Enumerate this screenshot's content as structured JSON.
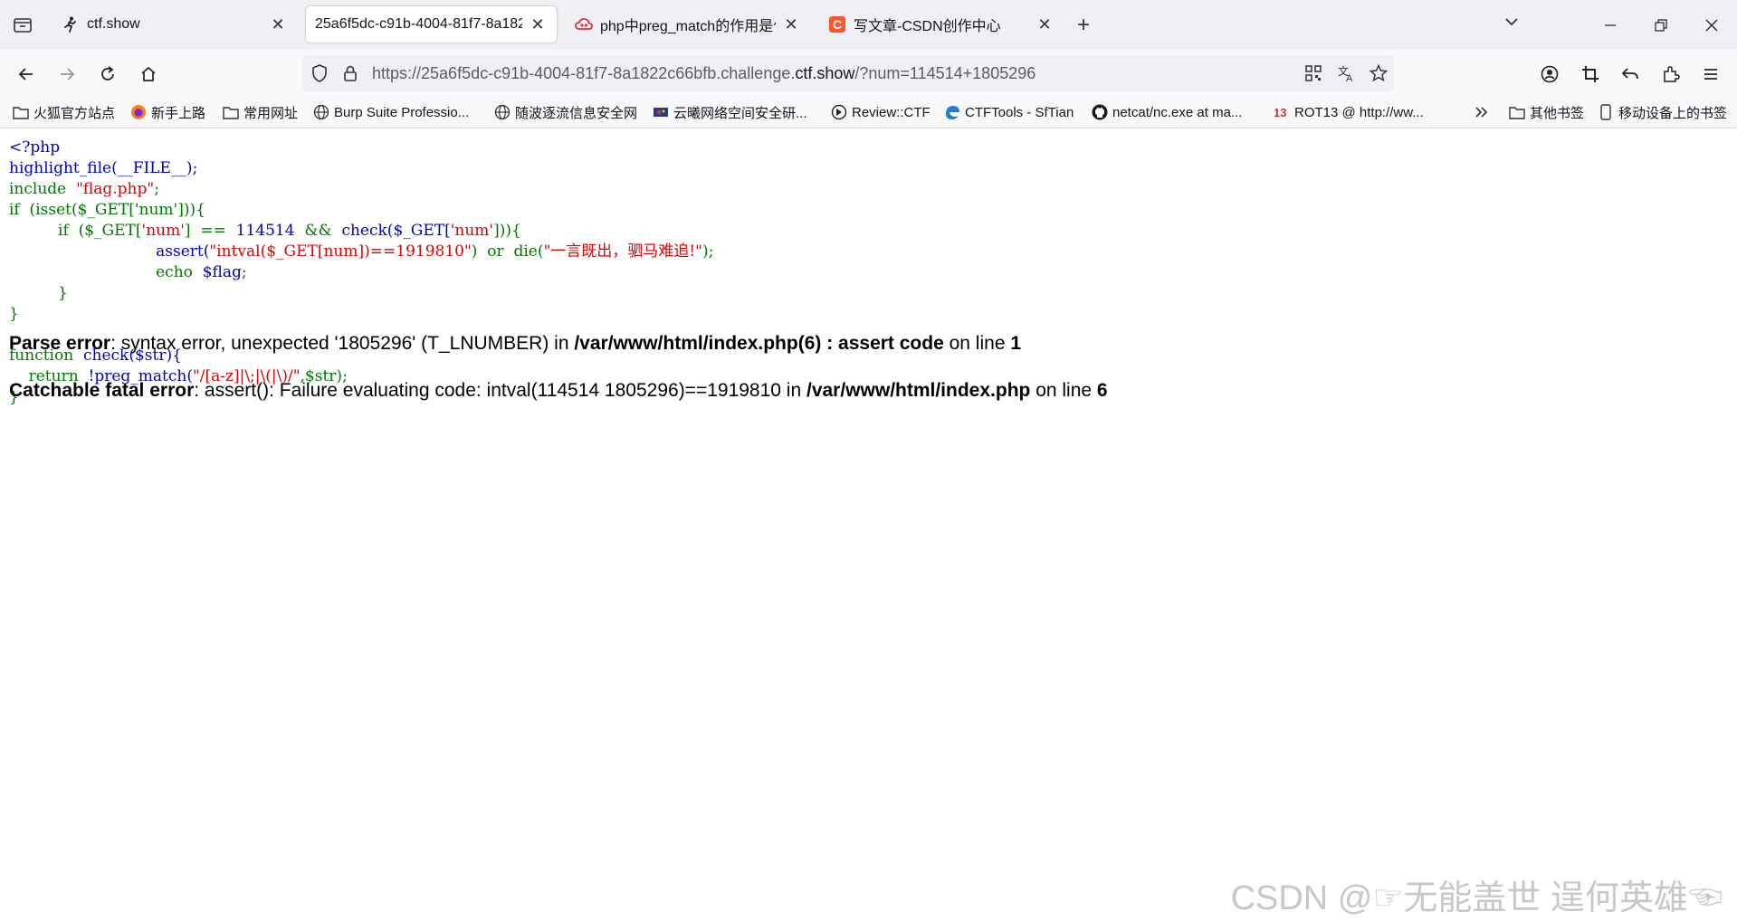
{
  "tabs": [
    {
      "title": "ctf.show",
      "favicon": "running-person-icon"
    },
    {
      "title": "25a6f5dc-c91b-4004-81f7-8a182",
      "favicon": "none"
    },
    {
      "title": "php中preg_match的作用是什么",
      "favicon": "cloud-icon"
    },
    {
      "title": "写文章-CSDN创作中心",
      "favicon": "csdn-c-icon"
    }
  ],
  "url": {
    "prefix": "https://25a6f5dc-c91b-4004-81f7-8a1822c66bfb.challenge.",
    "domain": "ctf.show",
    "suffix": "/?num=114514+1805296"
  },
  "bookmarks": [
    {
      "label": "火狐官方站点",
      "icon": "folder-icon"
    },
    {
      "label": "新手上路",
      "icon": "firefox-icon"
    },
    {
      "label": "常用网址",
      "icon": "folder-icon"
    },
    {
      "label": "Burp Suite Professio...",
      "icon": "globe-icon"
    },
    {
      "label": "随波逐流信息安全网",
      "icon": "globe-icon"
    },
    {
      "label": "云曦网络空间安全研...",
      "icon": "site-icon"
    },
    {
      "label": "Review::CTF",
      "icon": "review-icon"
    },
    {
      "label": "CTFTools - SfTian",
      "icon": "edge-icon"
    },
    {
      "label": "netcat/nc.exe at ma...",
      "icon": "github-icon"
    },
    {
      "label": "ROT13 @ http://ww...",
      "icon": "rot13-icon"
    },
    {
      "label": "其他书签",
      "icon": "folder-icon"
    },
    {
      "label": "移动设备上的书签",
      "icon": "phone-icon"
    }
  ],
  "code": {
    "l1": "<?php",
    "l2": "highlight_file(__FILE__);",
    "l3_kw": "include",
    "l3_str": "\"flag.php\"",
    "l3_end": ";",
    "l4_kw": "if",
    "l4_rest": "(isset($_GET['num'])){",
    "l5_kw": "if",
    "l5_a": "($_GET[",
    "l5_s1": "'num'",
    "l5_b": "]",
    "l5_op": "==",
    "l5_num": "114514",
    "l5_and": "&&",
    "l5_c": "check($_GET[",
    "l5_s2": "'num'",
    "l5_d": "])){",
    "l6_a": "assert(",
    "l6_s1": "\"intval($_GET[num])==1919810\"",
    "l6_b": ")",
    "l6_or": "or",
    "l6_die": "die(",
    "l6_s2": "\"一言既出，驷马难追!\"",
    "l6_end": ");",
    "l7_kw": "echo",
    "l7_var": "$flag",
    "l7_end": ";",
    "l8": "}",
    "l9": "}",
    "l11_kw": "function",
    "l11_rest": "check($str){",
    "l12_kw": "return",
    "l12_a": "!preg_match(",
    "l12_s": "\"/[a-z]|\\;|\\(|\\)/\"",
    "l12_b": ",$str);",
    "l13": "}"
  },
  "errors": {
    "e1_label": "Parse error",
    "e1_msg": ": syntax error, unexpected '1805296' (T_LNUMBER) in ",
    "e1_file": "/var/www/html/index.php(6) : assert code",
    "e1_online": " on line ",
    "e1_line": "1",
    "e2_label": "Catchable fatal error",
    "e2_msg": ": assert(): Failure evaluating code: intval(114514 1805296)==1919810 in ",
    "e2_file": "/var/www/html/index.php",
    "e2_online": " on line ",
    "e2_line": "6"
  },
  "watermark": "CSDN @☞无能盖世 逞何英雄☜",
  "colors": {
    "keyword": "#007700",
    "string": "#DD0000",
    "default": "#0000BB"
  }
}
